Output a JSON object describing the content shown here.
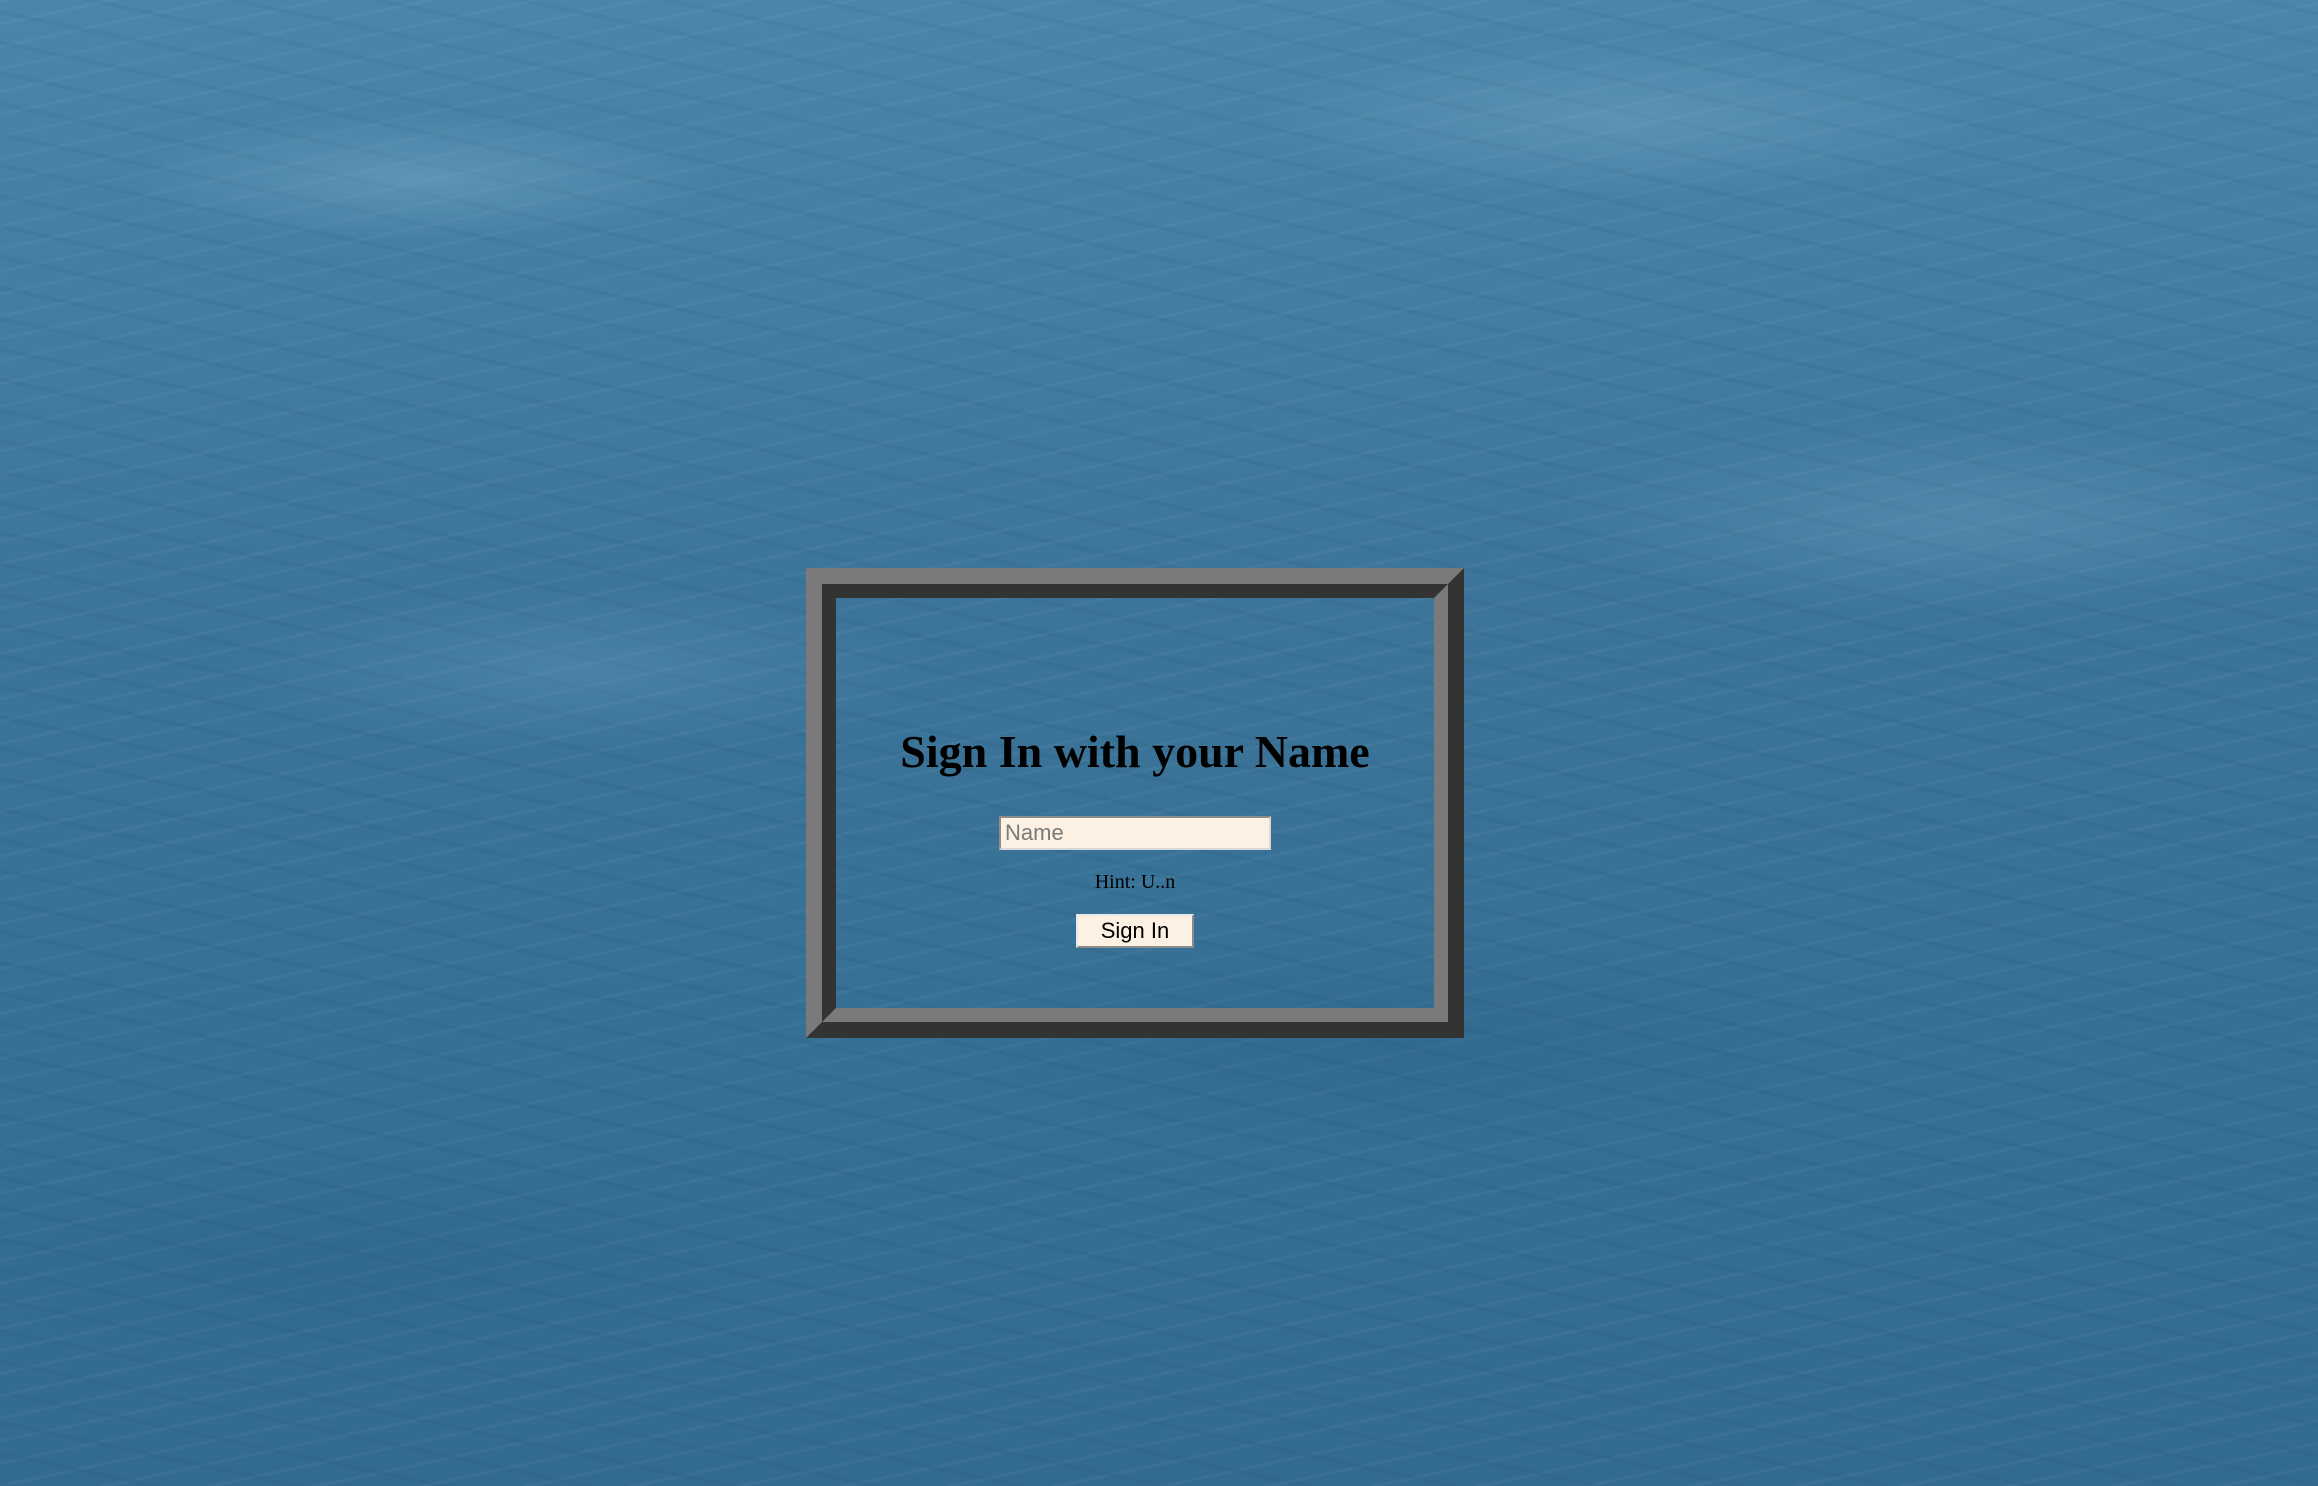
{
  "login": {
    "title": "Sign In with your Name",
    "name_input": {
      "placeholder": "Name",
      "value": ""
    },
    "hint": "Hint: U..n",
    "submit_label": "Sign In"
  },
  "colors": {
    "background": "#3a7396",
    "frame_light": "#7a7a7a",
    "frame_dark": "#333333",
    "field_background": "#fdf1e3"
  }
}
